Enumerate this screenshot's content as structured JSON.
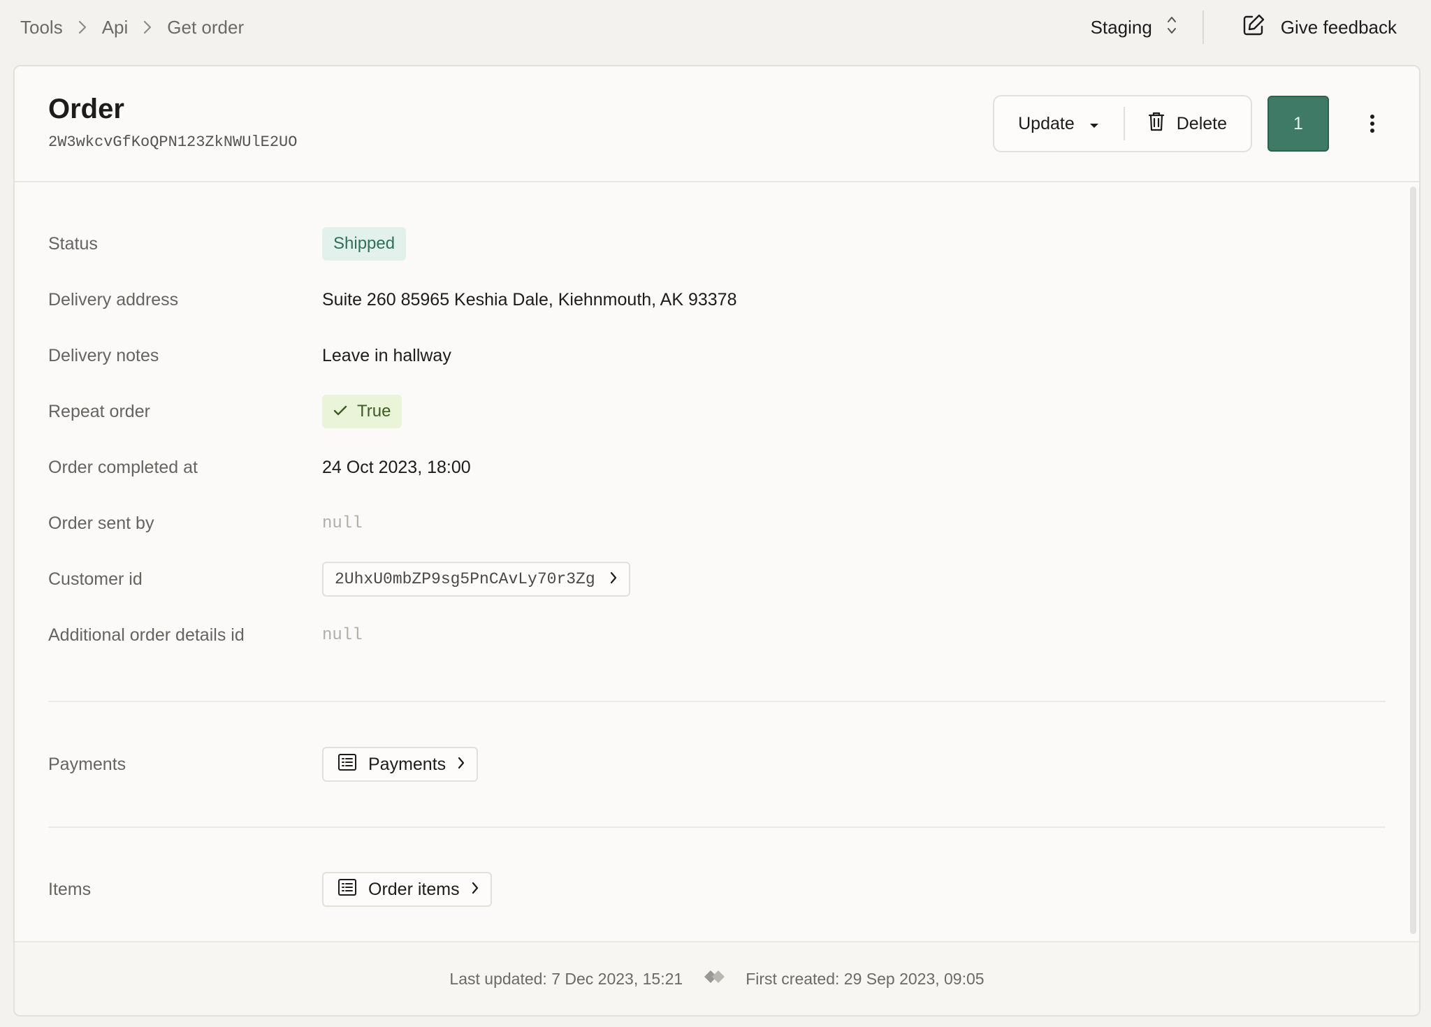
{
  "breadcrumb": {
    "items": [
      "Tools",
      "Api",
      "Get order"
    ]
  },
  "topbar": {
    "environment": "Staging",
    "feedback_label": "Give feedback"
  },
  "header": {
    "title": "Order",
    "record_id": "2W3wkcvGfKoQPN123ZkNWUlE2UO",
    "update_label": "Update",
    "delete_label": "Delete",
    "primary_label": "1"
  },
  "fields": {
    "status": {
      "label": "Status",
      "value": "Shipped"
    },
    "delivery_address": {
      "label": "Delivery address",
      "value": "Suite 260 85965 Keshia Dale, Kiehnmouth, AK 93378"
    },
    "delivery_notes": {
      "label": "Delivery notes",
      "value": "Leave in hallway"
    },
    "repeat_order": {
      "label": "Repeat order",
      "value": "True"
    },
    "order_completed_at": {
      "label": "Order completed at",
      "value": "24 Oct 2023, 18:00"
    },
    "order_sent_by": {
      "label": "Order sent by",
      "value": "null"
    },
    "customer_id": {
      "label": "Customer id",
      "value": "2UhxU0mbZP9sg5PnCAvLy70r3Zg"
    },
    "additional_order_details_id": {
      "label": "Additional order details id",
      "value": "null"
    }
  },
  "relations": {
    "payments": {
      "label": "Payments",
      "link_label": "Payments"
    },
    "items": {
      "label": "Items",
      "link_label": "Order items"
    }
  },
  "footer": {
    "last_updated": "Last updated: 7 Dec 2023, 15:21",
    "first_created": "First created: 29 Sep 2023, 09:05"
  },
  "colors": {
    "primary": "#3f7a66",
    "status_badge_bg": "#e3f1ec",
    "true_badge_bg": "#e9f4d9"
  },
  "icons": [
    "chevron-right-icon",
    "sort-arrows-icon",
    "edit-icon",
    "caret-down-icon",
    "trash-icon",
    "kebab-menu-icon",
    "check-icon",
    "list-icon",
    "diamond-arrow-icon"
  ]
}
